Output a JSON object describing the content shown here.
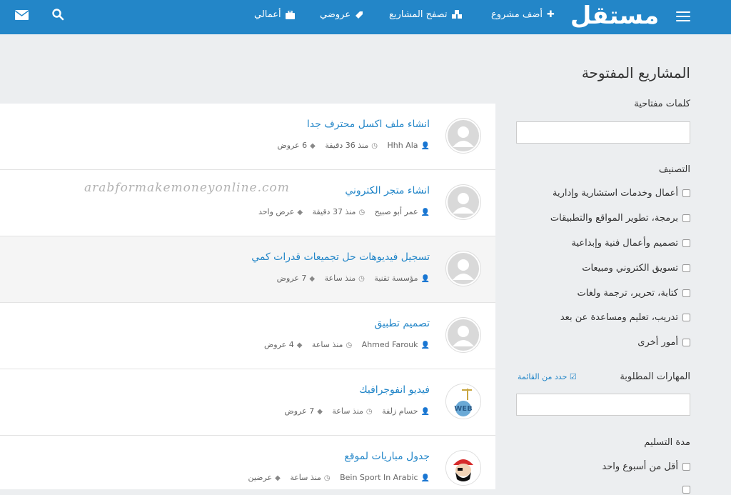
{
  "colors": {
    "brand": "#2386c8",
    "background": "#eceef0",
    "link": "#2386c8"
  },
  "header": {
    "logo_text": "مستقل",
    "nav": [
      {
        "label": "أضف مشروع",
        "icon": "plus-icon"
      },
      {
        "label": "تصفح المشاريع",
        "icon": "cubes-icon"
      },
      {
        "label": "عروضي",
        "icon": "tag-icon"
      },
      {
        "label": "أعمالي",
        "icon": "briefcase-icon"
      }
    ],
    "icons": [
      "menu-icon",
      "search-icon",
      "envelope-icon"
    ]
  },
  "sidebar": {
    "title": "المشاريع المفتوحة",
    "keywords_label": "كلمات مفتاحية",
    "keywords_value": "",
    "category_label": "التصنيف",
    "categories": [
      "أعمال وخدمات استشارية وإدارية",
      "برمجة، تطوير المواقع والتطبيقات",
      "تصميم وأعمال فنية وإبداعية",
      "تسويق الكتروني ومبيعات",
      "كتابة، تحرير، ترجمة ولغات",
      "تدريب، تعليم ومساعدة عن بعد",
      "أمور أخرى"
    ],
    "skills_label": "المهارات المطلوبة",
    "skills_link": "حدد من القائمة",
    "skills_value": "",
    "delivery_label": "مدة التسليم",
    "delivery_options": [
      "أقل من أسبوع واحد"
    ]
  },
  "projects": [
    {
      "title": "انشاء ملف اكسل محترف جدا",
      "owner": "Hhh Ala",
      "time": "منذ 36 دقيقة",
      "bids": "6 عروض",
      "avatar": "default-avatar-icon"
    },
    {
      "title": "انشاء متجر الكتروني",
      "owner": "عمر أبو صبيح",
      "time": "منذ 37 دقيقة",
      "bids": "عرض واحد",
      "avatar": "default-avatar-icon"
    },
    {
      "title": "تسجيل فيديوهات حل تجميعات قدرات كمي",
      "owner": "مؤسسة تقنية",
      "time": "منذ ساعة",
      "bids": "7 عروض",
      "avatar": "default-avatar-icon"
    },
    {
      "title": "تصميم تطبيق",
      "owner": "Ahmed Farouk",
      "time": "منذ ساعة",
      "bids": "4 عروض",
      "avatar": "default-avatar-icon"
    },
    {
      "title": "فيديو انفوجرافيك",
      "owner": "حسام زلفة",
      "time": "منذ ساعة",
      "bids": "7 عروض",
      "avatar": "web-globe-avatar-icon"
    },
    {
      "title": "جدول مباريات لموقع",
      "owner": "Bein Sport In Arabic",
      "time": "منذ ساعة",
      "bids": "عرضين",
      "avatar": "pirate-avatar-icon"
    }
  ],
  "watermark": "arabformakemoneyonline.com"
}
